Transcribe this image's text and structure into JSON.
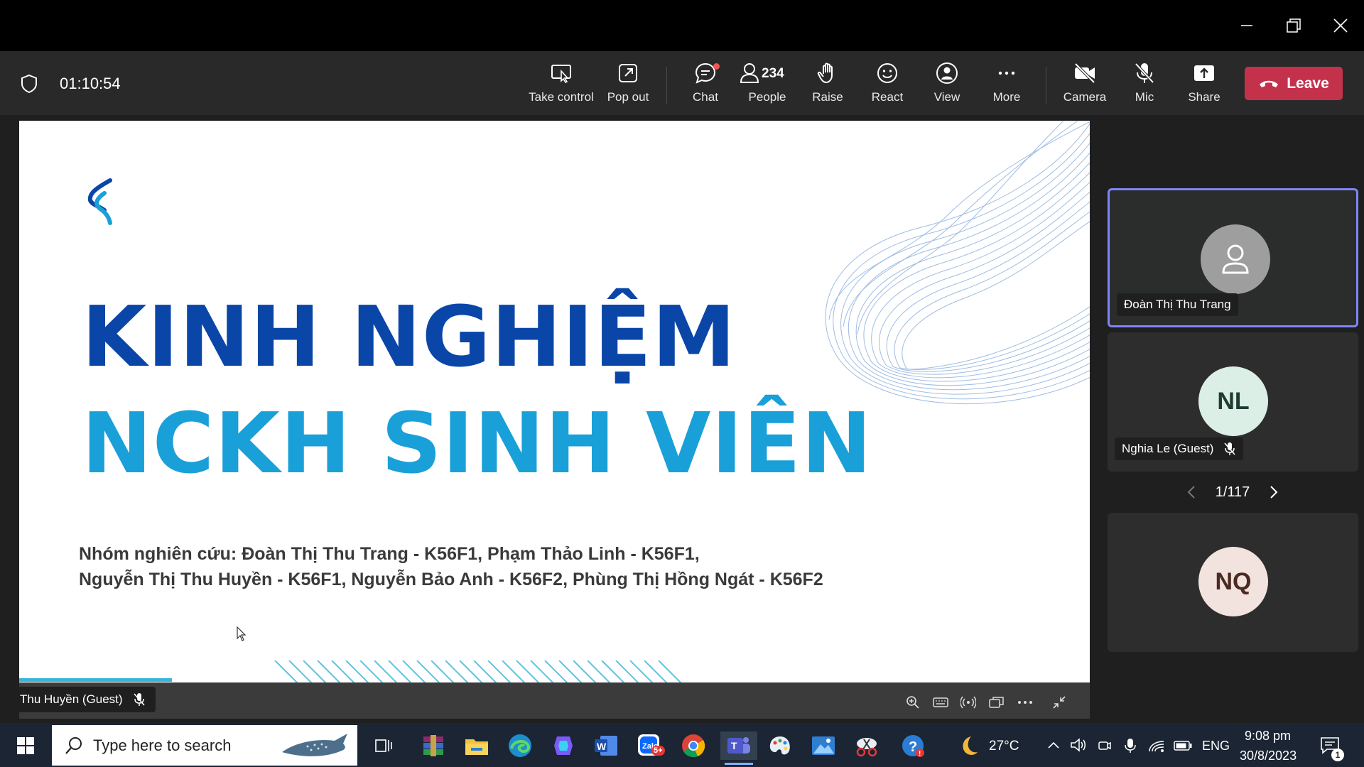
{
  "meeting": {
    "timer": "01:10:54",
    "toolbar": {
      "take_control": "Take control",
      "pop_out": "Pop out",
      "chat": "Chat",
      "people": "People",
      "people_count": "234",
      "raise": "Raise",
      "react": "React",
      "view": "View",
      "more": "More",
      "camera": "Camera",
      "mic": "Mic",
      "share": "Share",
      "leave": "Leave"
    },
    "slide": {
      "title_line1": "KINH NGHIỆM",
      "title_line2": "NCKH SINH VIÊN",
      "subtitle_line1": "Nhóm nghiên cứu: Đoàn Thị Thu Trang - K56F1, Phạm Thảo Linh - K56F1,",
      "subtitle_line2": "Nguyễn Thị Thu Huyền - K56F1, Nguyễn Bảo Anh - K56F2, Phùng Thị Hồng Ngát - K56F2"
    },
    "presenter": "Thu Huyền (Guest)",
    "participants": [
      {
        "name": "Đoàn Thị Thu Trang",
        "initials": ""
      },
      {
        "name": "Nghia Le (Guest)",
        "initials": "NL"
      },
      {
        "name": "",
        "initials": "NQ"
      }
    ],
    "pager": "1/117"
  },
  "taskbar": {
    "search_placeholder": "Type here to search",
    "zalo_badge": "5+",
    "weather": "27°C",
    "language": "ENG",
    "time": "9:08 pm",
    "date": "30/8/2023",
    "notification_count": "1"
  },
  "colors": {
    "leave": "#c4314b",
    "active_border": "#7f85f5",
    "title_dark_blue": "#0a46a8",
    "title_light_blue": "#1aa0d8"
  }
}
